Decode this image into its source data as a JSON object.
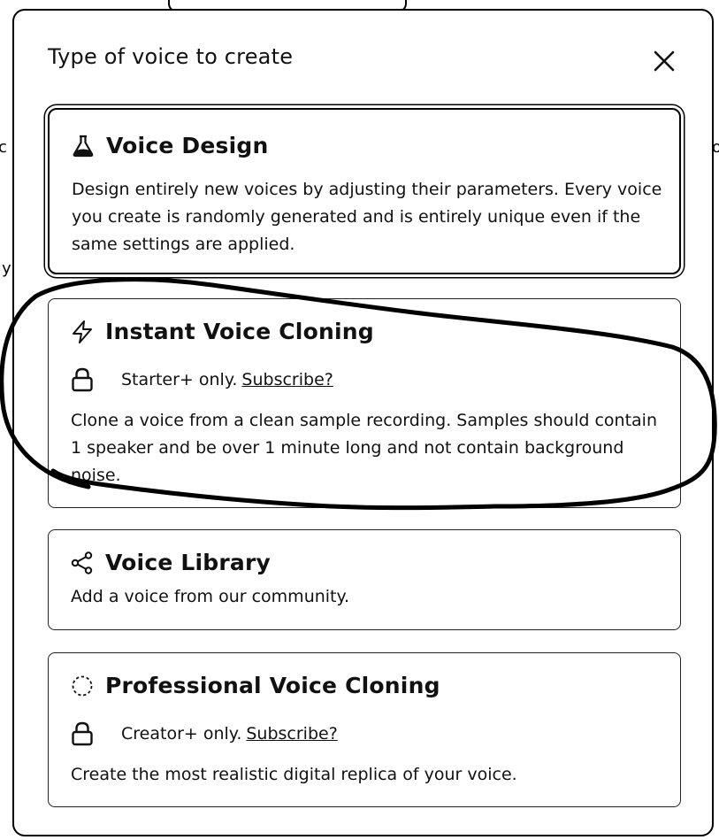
{
  "modal": {
    "title": "Type of voice to create"
  },
  "options": [
    {
      "title": "Voice Design",
      "icon": "flask-icon",
      "description": "Design entirely new voices by adjusting their parameters. Every voice you create is randomly generated and is entirely unique even if the same settings are applied.",
      "selected": true
    },
    {
      "title": "Instant Voice Cloning",
      "icon": "lightning-icon",
      "requirement": "Starter+ only.",
      "link": "Subscribe?",
      "description": "Clone a voice from a clean sample recording. Samples should contain 1 speaker and be over 1 minute long and not contain background noise."
    },
    {
      "title": "Voice Library",
      "icon": "share-icon",
      "description": "Add a voice from our community."
    },
    {
      "title": "Professional Voice Cloning",
      "icon": "dashed-circle-icon",
      "requirement": "Creator+ only.",
      "link": "Subscribe?",
      "description": "Create the most realistic digital replica of your voice."
    }
  ],
  "background": {
    "fragments": [
      "c",
      "y",
      "o"
    ]
  },
  "colors": {
    "ink": "#111111",
    "border": "#222222",
    "background": "#ffffff"
  }
}
